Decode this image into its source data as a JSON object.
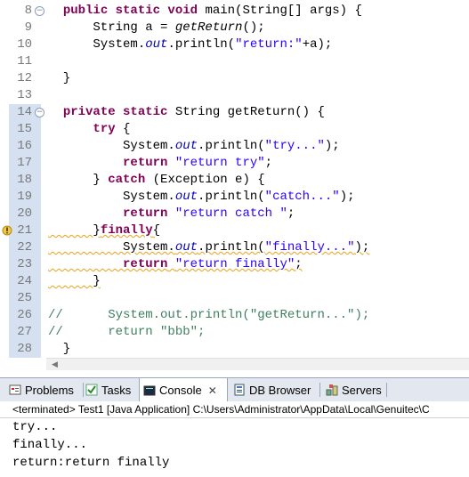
{
  "editor": {
    "lines": [
      {
        "n": "8",
        "fold": "−"
      },
      {
        "n": "9"
      },
      {
        "n": "10"
      },
      {
        "n": "11"
      },
      {
        "n": "12"
      },
      {
        "n": "13"
      },
      {
        "n": "14",
        "fold": "−"
      },
      {
        "n": "15"
      },
      {
        "n": "16"
      },
      {
        "n": "17"
      },
      {
        "n": "18"
      },
      {
        "n": "19"
      },
      {
        "n": "20"
      },
      {
        "n": "21",
        "warn": true
      },
      {
        "n": "22"
      },
      {
        "n": "23"
      },
      {
        "n": "24"
      },
      {
        "n": "25"
      },
      {
        "n": "26"
      },
      {
        "n": "27"
      },
      {
        "n": "28"
      }
    ],
    "code": [
      [
        "  ",
        [
          "kw",
          "public static void"
        ],
        " main(String[] args) {"
      ],
      [
        "      String a = ",
        [
          "ital",
          "getReturn"
        ],
        "();"
      ],
      [
        "      System.",
        [
          "fld",
          "out"
        ],
        ".println(",
        [
          "str",
          "\"return:\""
        ],
        "+a);"
      ],
      [
        ""
      ],
      [
        "  }"
      ],
      [
        ""
      ],
      [
        "  ",
        [
          "kw",
          "private static"
        ],
        " String getReturn() {"
      ],
      [
        "      ",
        [
          "kw",
          "try"
        ],
        " {"
      ],
      [
        "          System.",
        [
          "fld",
          "out"
        ],
        ".println(",
        [
          "str",
          "\"try...\""
        ],
        ");"
      ],
      [
        "          ",
        [
          "kw",
          "return"
        ],
        " ",
        [
          "str",
          "\"return try\""
        ],
        ";"
      ],
      [
        "      } ",
        [
          "kw",
          "catch"
        ],
        " (Exception e) {"
      ],
      [
        "          System.",
        [
          "fld",
          "out"
        ],
        ".println(",
        [
          "str",
          "\"catch...\""
        ],
        ");"
      ],
      [
        "          ",
        [
          "kw",
          "return"
        ],
        " ",
        [
          "str",
          "\"return catch \""
        ],
        ";"
      ],
      [
        "      }",
        [
          "kw",
          "finally"
        ],
        "{"
      ],
      [
        "          System.",
        [
          "fld",
          "out"
        ],
        ".println(",
        [
          "str",
          "\"finally...\""
        ],
        ");"
      ],
      [
        "          ",
        [
          "kw",
          "return"
        ],
        " ",
        [
          "str",
          "\"return finally\""
        ],
        ";"
      ],
      [
        "      }"
      ],
      [
        ""
      ],
      [
        [
          "cm",
          "//      System.out.println(\"getReturn...\");"
        ]
      ],
      [
        [
          "cm",
          "//      return \"bbb\";"
        ]
      ],
      [
        "  }"
      ]
    ]
  },
  "tabs": [
    {
      "label": "Problems",
      "icon": "problems-icon"
    },
    {
      "label": "Tasks",
      "icon": "tasks-icon"
    },
    {
      "label": "Console",
      "icon": "console-icon",
      "active": true
    },
    {
      "label": "DB Browser",
      "icon": "db-browser-icon"
    },
    {
      "label": "Servers",
      "icon": "servers-icon"
    }
  ],
  "status_line": "<terminated> Test1 [Java Application] C:\\Users\\Administrator\\AppData\\Local\\Genuitec\\C",
  "console_output": [
    "try...",
    "finally...",
    "return:return finally"
  ]
}
